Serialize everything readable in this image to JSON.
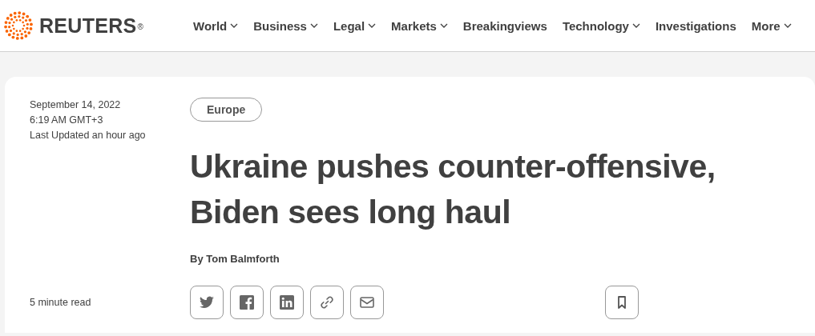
{
  "brand": {
    "name": "REUTERS",
    "mark": "®"
  },
  "nav": [
    {
      "label": "World",
      "menu": true
    },
    {
      "label": "Business",
      "menu": true
    },
    {
      "label": "Legal",
      "menu": true
    },
    {
      "label": "Markets",
      "menu": true
    },
    {
      "label": "Breakingviews",
      "menu": false
    },
    {
      "label": "Technology",
      "menu": true
    },
    {
      "label": "Investigations",
      "menu": false
    },
    {
      "label": "More",
      "menu": true
    }
  ],
  "article": {
    "date": "September 14, 2022",
    "time": "6:19 AM GMT+3",
    "updated": "Last Updated an hour ago",
    "tag": "Europe",
    "headline": "Ukraine pushes counter-offensive, Biden sees long haul",
    "byline": "By Tom Balmforth",
    "read_time": "5 minute read",
    "share": [
      {
        "kind": "twitter"
      },
      {
        "kind": "facebook"
      },
      {
        "kind": "linkedin"
      },
      {
        "kind": "link"
      },
      {
        "kind": "email"
      }
    ],
    "bookmark": {
      "kind": "bookmark"
    }
  }
}
